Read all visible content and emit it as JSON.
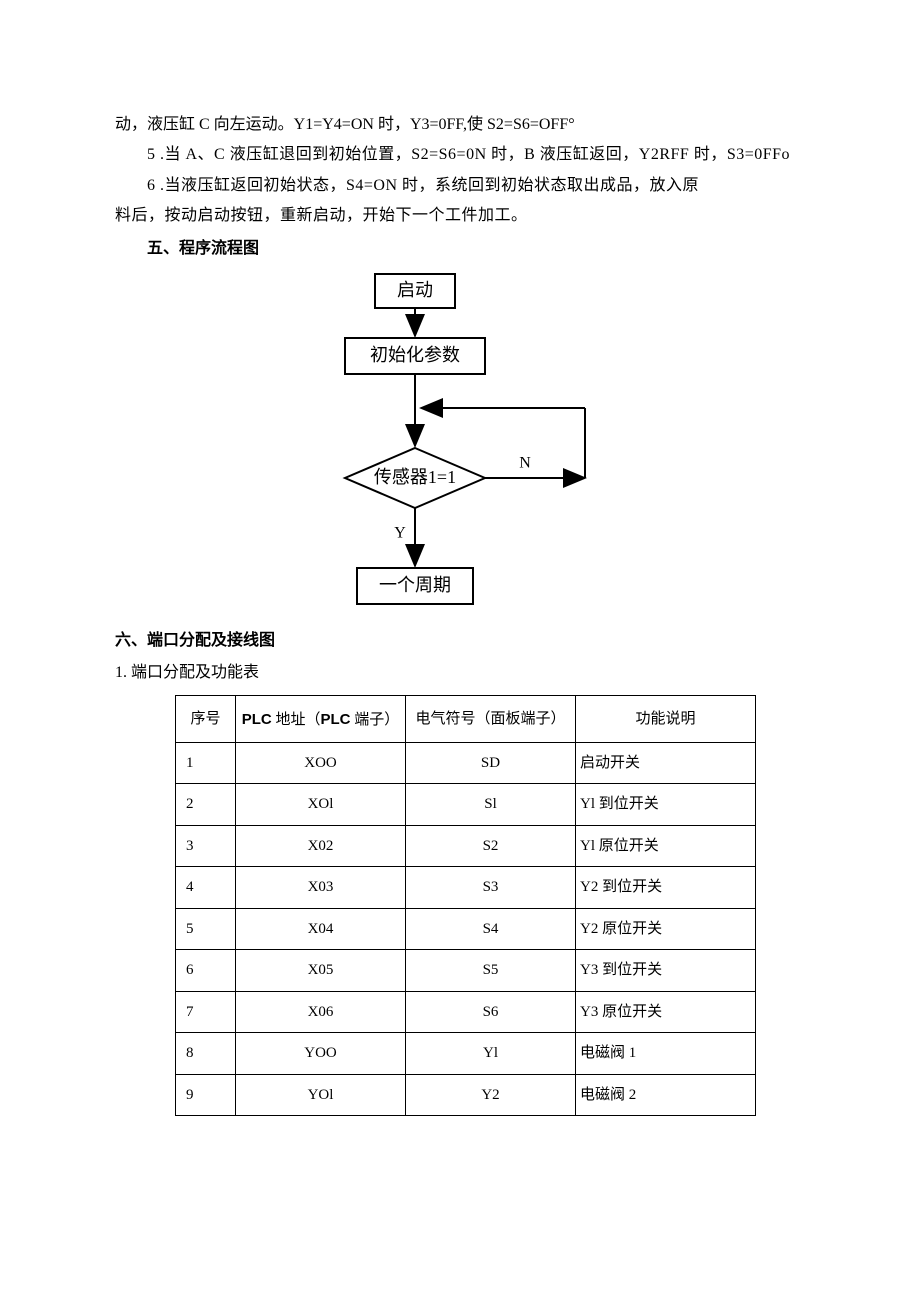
{
  "paragraphs": {
    "p0": "动，液压缸 C 向左运动。Y1=Y4=ON 时，Y3=0FF,使 S2=S6=OFF°",
    "p5": "5  .当 A、C 液压缸退回到初始位置，S2=S6=0N 时，B 液压缸返回，Y2RFF 时，S3=0FFo",
    "p6a": "6  .当液压缸返回初始状态，S4=ON 时，系统回到初始状态取出成品，放入原",
    "p6b": "料后，按动启动按钮，重新启动，开始下一个工件加工。"
  },
  "headings": {
    "h5": "五、程序流程图",
    "h6": "六、端口分配及接线图",
    "sub61": "1. 端口分配及功能表"
  },
  "flowchart": {
    "start": "启动",
    "init": "初始化参数",
    "cond": "传感器1=1",
    "n": "N",
    "y": "Y",
    "cycle": "一个周期"
  },
  "table": {
    "headers": {
      "idx": "序号",
      "plcBold": "PLC",
      "plcRest1": " 地址（",
      "plcBold2": "PLC",
      "plcRest2": " 端子）",
      "sym": "电气符号（面板端子）",
      "fn": "功能说明"
    },
    "rows": [
      {
        "idx": "1",
        "plc": "XOO",
        "sym": "SD",
        "fn": "启动开关"
      },
      {
        "idx": "2",
        "plc": "XOl",
        "sym": "Sl",
        "fn": "Yl 到位开关"
      },
      {
        "idx": "3",
        "plc": "X02",
        "sym": "S2",
        "fn": "Yl 原位开关"
      },
      {
        "idx": "4",
        "plc": "X03",
        "sym": "S3",
        "fn": "Y2 到位开关"
      },
      {
        "idx": "5",
        "plc": "X04",
        "sym": "S4",
        "fn": "Y2 原位开关"
      },
      {
        "idx": "6",
        "plc": "X05",
        "sym": "S5",
        "fn": "Y3 到位开关"
      },
      {
        "idx": "7",
        "plc": "X06",
        "sym": "S6",
        "fn": "Y3 原位开关"
      },
      {
        "idx": "8",
        "plc": "YOO",
        "sym": "Yl",
        "fn": "电磁阀 1"
      },
      {
        "idx": "9",
        "plc": "YOl",
        "sym": "Y2",
        "fn": "电磁阀 2"
      }
    ]
  }
}
